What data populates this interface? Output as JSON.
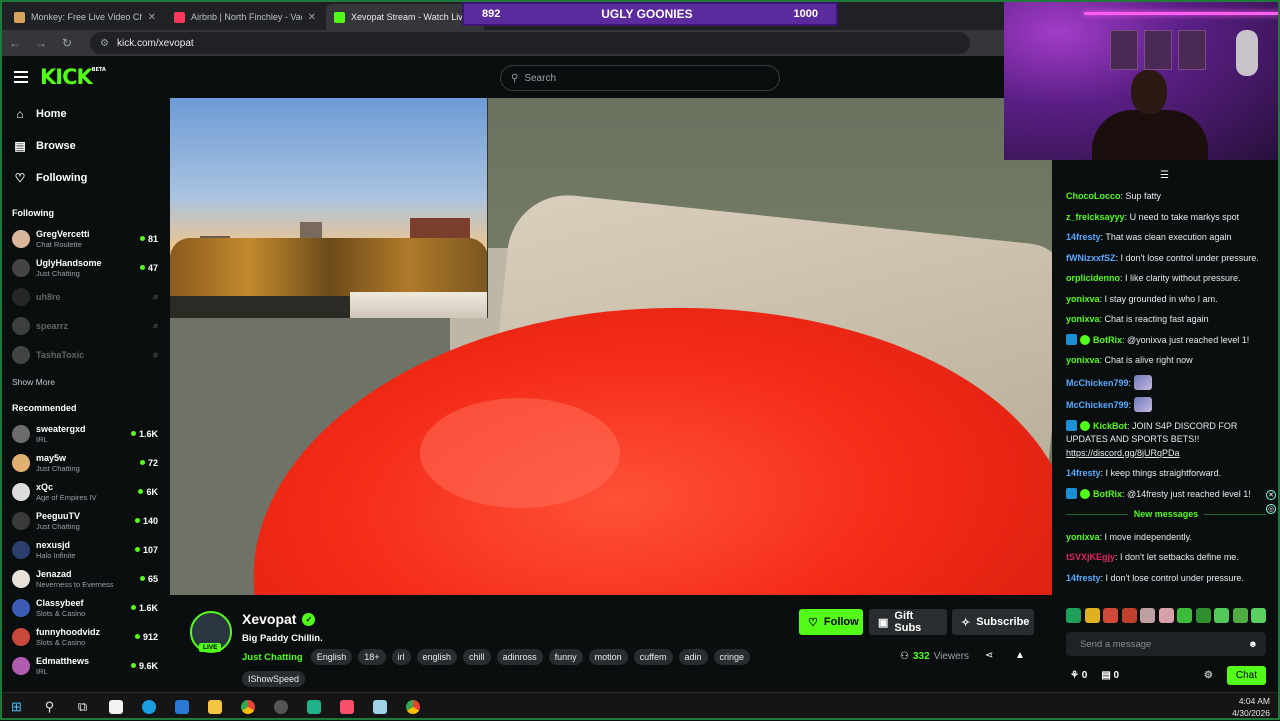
{
  "browser": {
    "tabs": [
      {
        "title": "Monkey: Free Live Video Chat w",
        "active": false,
        "favicon_color": "#d8a35a"
      },
      {
        "title": "Airbnb | North Finchley - Vacati",
        "active": false,
        "favicon_color": "#ff385c"
      },
      {
        "title": "Xevopat Stream - Watch Live o",
        "active": true,
        "favicon_color": "#53fc18"
      }
    ],
    "url": "kick.com/xevopat"
  },
  "overlay_banner": {
    "left_value": "892",
    "title": "UGLY GOONIES",
    "right_value": "1000"
  },
  "header": {
    "logo": "KICK",
    "logo_badge": "BETA",
    "search_placeholder": "Search"
  },
  "sidebar": {
    "nav": [
      {
        "label": "Home",
        "icon": "home-icon",
        "glyph": "⌂"
      },
      {
        "label": "Browse",
        "icon": "browse-icon",
        "glyph": "▤"
      },
      {
        "label": "Following",
        "icon": "heart-icon",
        "glyph": "♡"
      }
    ],
    "following_title": "Following",
    "following": [
      {
        "name": "GregVercetti",
        "sub": "Chat Roulette",
        "viewers": "81",
        "color": "#d9b59a",
        "live": true
      },
      {
        "name": "UglyHandsome",
        "sub": "Just Chatting",
        "viewers": "47",
        "color": "#444",
        "live": true
      },
      {
        "name": "uh8re",
        "sub": "",
        "viewers": "⌀",
        "color": "#555",
        "live": false
      },
      {
        "name": "spearrz",
        "sub": "",
        "viewers": "⌀",
        "color": "#999",
        "live": false
      },
      {
        "name": "TashaToxic",
        "sub": "",
        "viewers": "⌀",
        "color": "#aaa",
        "live": false
      }
    ],
    "show_more": "Show More",
    "recommended_title": "Recommended",
    "recommended": [
      {
        "name": "sweatergxd",
        "sub": "IRL",
        "viewers": "1.6K",
        "color": "#6b6b6b"
      },
      {
        "name": "may5w",
        "sub": "Just Chatting",
        "viewers": "72",
        "color": "#e0b070"
      },
      {
        "name": "xQc",
        "sub": "Age of Empires IV",
        "viewers": "6K",
        "color": "#ddd"
      },
      {
        "name": "PeeguuTV",
        "sub": "Just Chatting",
        "viewers": "140",
        "color": "#3a3a3a"
      },
      {
        "name": "nexusjd",
        "sub": "Halo Infinite",
        "viewers": "107",
        "color": "#2c3e6e"
      },
      {
        "name": "Jenazad",
        "sub": "Neverness to Everness",
        "viewers": "65",
        "color": "#e7e1d8"
      },
      {
        "name": "Classybeef",
        "sub": "Slots & Casino",
        "viewers": "1.6K",
        "color": "#3b5bb5"
      },
      {
        "name": "funnyhoodvidz",
        "sub": "Slots & Casino",
        "viewers": "912",
        "color": "#c74a3a"
      },
      {
        "name": "Edmatthews",
        "sub": "IRL",
        "viewers": "9.6K",
        "color": "#b05ab0"
      }
    ]
  },
  "channel": {
    "name": "Xevopat",
    "live_label": "LIVE",
    "stream_title": "Big Paddy Chillin.",
    "category": "Just Chatting",
    "tags": [
      "English",
      "18+",
      "irl",
      "english",
      "chill",
      "adinross",
      "funny",
      "motion",
      "cuffem",
      "adin",
      "cringe",
      "IShowSpeed"
    ],
    "follow_label": "Follow",
    "gift_label": "Gift Subs",
    "subscribe_label": "Subscribe",
    "viewers_count": "332",
    "viewers_label": "Viewers"
  },
  "chat": {
    "messages": [
      {
        "user": "ChocoLocco",
        "color": "#53fc18",
        "text": "Sup fatty",
        "bot": false
      },
      {
        "user": "z_freicksayyy",
        "color": "#53fc18",
        "text": "U need to take markys spot",
        "bot": false
      },
      {
        "user": "14fresty",
        "color": "#5aa9ff",
        "text": "That was clean execution again",
        "bot": false
      },
      {
        "user": "fWNizxxfSZ",
        "color": "#5aa9ff",
        "text": "I don't lose control under pressure.",
        "bot": false
      },
      {
        "user": "orplicidenno",
        "color": "#53fc18",
        "text": "I like clarity without pressure.",
        "bot": false
      },
      {
        "user": "yonixva",
        "color": "#53fc18",
        "text": "I stay grounded in who I am.",
        "bot": false
      },
      {
        "user": "yonixva",
        "color": "#53fc18",
        "text": "Chat is reacting fast again",
        "bot": false
      },
      {
        "user": "BotRix",
        "color": "#53fc18",
        "text": "@yonixva just reached level 1!",
        "bot": true
      },
      {
        "user": "yonixva",
        "color": "#53fc18",
        "text": "Chat is alive right now",
        "bot": false
      },
      {
        "user": "McChicken799",
        "color": "#5aa9ff",
        "text": "",
        "bot": false,
        "emote": true
      },
      {
        "user": "McChicken799",
        "color": "#5aa9ff",
        "text": "",
        "bot": false,
        "emote": true
      },
      {
        "user": "KickBot",
        "color": "#53fc18",
        "text": "JOIN S4P DISCORD FOR UPDATES AND SPORTS BETS!!",
        "bot": true,
        "link": "https://discord.gg/8jURqPDa"
      },
      {
        "user": "14fresty",
        "color": "#5aa9ff",
        "text": "I keep things straightforward.",
        "bot": false
      },
      {
        "user": "BotRix",
        "color": "#53fc18",
        "text": "@14fresty just reached level 1!",
        "bot": true
      }
    ],
    "new_messages_label": "New messages",
    "new_messages": [
      {
        "user": "yonixva",
        "color": "#53fc18",
        "text": "I move independently.",
        "bot": false
      },
      {
        "user": "tSVXjKEgjy",
        "color": "#e0245e",
        "text": "I don't let setbacks define me.",
        "bot": false
      },
      {
        "user": "14fresty",
        "color": "#5aa9ff",
        "text": "I don't lose control under pressure.",
        "bot": false
      }
    ],
    "input_placeholder": "Send a message",
    "points": "0",
    "subs": "0",
    "chat_button": "Chat"
  },
  "taskbar": {
    "time": "4:04 AM",
    "date": "4/30/2026"
  }
}
